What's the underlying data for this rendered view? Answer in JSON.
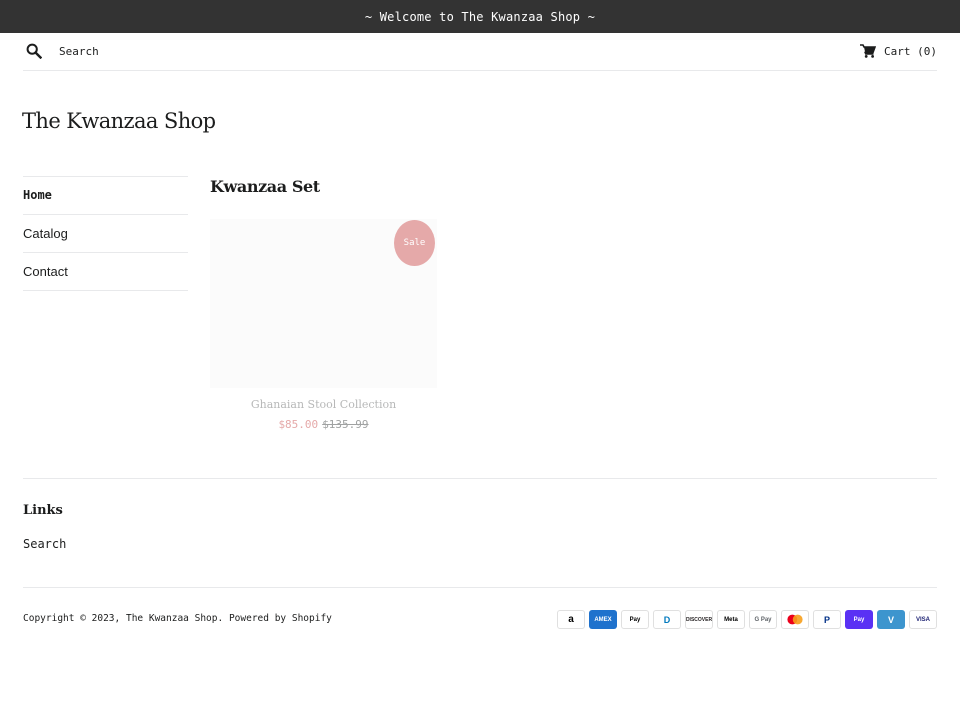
{
  "announcement": {
    "text": "~ Welcome to The Kwanzaa Shop ~"
  },
  "header": {
    "search_placeholder": "Search",
    "search_icon": "search-icon",
    "cart_icon": "cart-icon",
    "cart_label": "Cart (0)"
  },
  "site": {
    "title": "The Kwanzaa Shop"
  },
  "sidebar": {
    "items": [
      {
        "label": "Home",
        "active": true
      },
      {
        "label": "Catalog",
        "active": false
      },
      {
        "label": "Contact",
        "active": false
      }
    ]
  },
  "collection": {
    "title": "Kwanzaa Set",
    "products": [
      {
        "badge": "Sale",
        "name": "Ghanaian Stool Collection",
        "price": "$85.00",
        "compare_price": "$135.99"
      }
    ]
  },
  "footer": {
    "links_heading": "Links",
    "links": [
      {
        "label": "Search"
      }
    ],
    "copyright_prefix": "Copyright © 2023,",
    "shop_link": "The Kwanzaa Shop",
    "powered_by": "Powered by Shopify",
    "payment_icons": [
      {
        "name": "amazon-icon",
        "text": "a",
        "bg": "#ffffff",
        "fg": "#000000"
      },
      {
        "name": "american-express-icon",
        "text": "AMEX",
        "bg": "#1f72cd",
        "fg": "#ffffff"
      },
      {
        "name": "apple-pay-icon",
        "text": "Pay",
        "bg": "#ffffff",
        "fg": "#000000"
      },
      {
        "name": "diners-club-icon",
        "text": "D",
        "bg": "#ffffff",
        "fg": "#0079be"
      },
      {
        "name": "discover-icon",
        "text": "DISCOVER",
        "bg": "#ffffff",
        "fg": "#231f20"
      },
      {
        "name": "meta-pay-icon",
        "text": "Meta",
        "bg": "#ffffff",
        "fg": "#000000"
      },
      {
        "name": "google-pay-icon",
        "text": "G Pay",
        "bg": "#ffffff",
        "fg": "#5f6368"
      },
      {
        "name": "mastercard-icon",
        "text": "",
        "bg": "#ffffff",
        "fg": "#eb001b"
      },
      {
        "name": "paypal-icon",
        "text": "P",
        "bg": "#ffffff",
        "fg": "#003087"
      },
      {
        "name": "shop-pay-icon",
        "text": "Pay",
        "bg": "#5a31f4",
        "fg": "#ffffff"
      },
      {
        "name": "venmo-icon",
        "text": "V",
        "bg": "#3d95ce",
        "fg": "#ffffff"
      },
      {
        "name": "visa-icon",
        "text": "VISA",
        "bg": "#ffffff",
        "fg": "#1a1f71"
      }
    ]
  },
  "colors": {
    "announcement_bg": "#333333",
    "sale_accent": "#e5a9a9",
    "text": "#1c1d1d",
    "divider": "#e8e9eb"
  }
}
